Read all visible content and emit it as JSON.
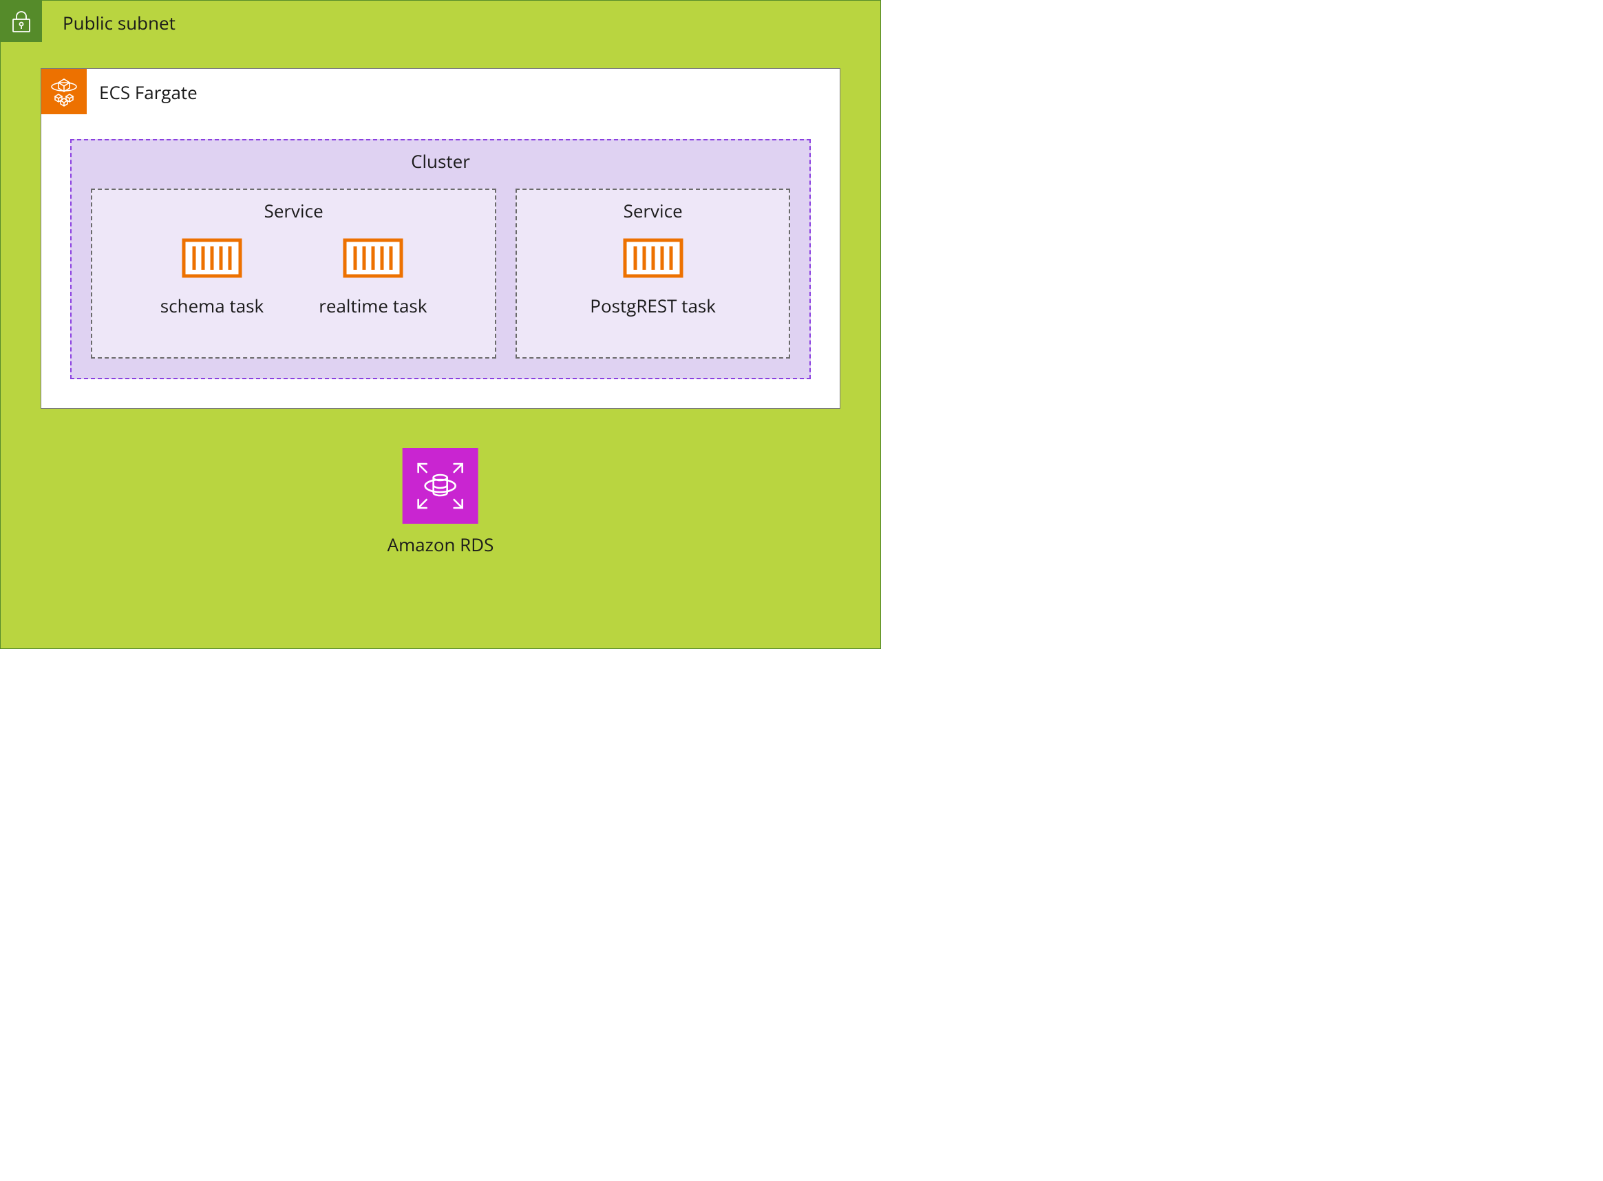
{
  "subnet": {
    "label": "Public subnet",
    "icon": "lock-icon"
  },
  "fargate": {
    "label": "ECS Fargate",
    "icon": "containers-icon",
    "cluster": {
      "label": "Cluster",
      "services": [
        {
          "label": "Service",
          "tasks": [
            {
              "label": "schema task",
              "icon": "container-icon"
            },
            {
              "label": "realtime task",
              "icon": "container-icon"
            }
          ]
        },
        {
          "label": "Service",
          "tasks": [
            {
              "label": "PostgREST task",
              "icon": "container-icon"
            }
          ]
        }
      ]
    }
  },
  "rds": {
    "label": "Amazon RDS",
    "icon": "rds-icon"
  },
  "colors": {
    "subnet_bg": "#b9d540",
    "subnet_border": "#558b2a",
    "fargate_accent": "#ed7100",
    "cluster_border": "#8a3fe0",
    "cluster_bg": "#dfd2f2",
    "service_bg": "#eee7f8",
    "rds_accent": "#c925d1"
  }
}
